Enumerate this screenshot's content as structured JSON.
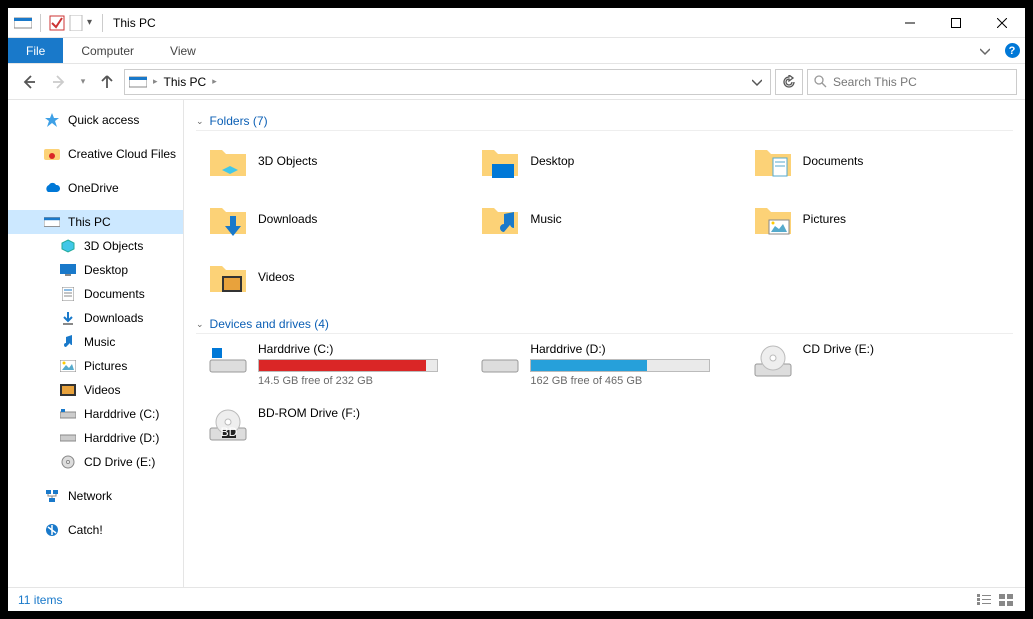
{
  "window": {
    "title": "This PC"
  },
  "menu": {
    "file": "File",
    "computer": "Computer",
    "view": "View"
  },
  "address": {
    "location": "This PC",
    "search_placeholder": "Search This PC"
  },
  "tree": {
    "quick_access": "Quick access",
    "creative_cloud": "Creative Cloud Files",
    "onedrive": "OneDrive",
    "this_pc": "This PC",
    "objects3d": "3D Objects",
    "desktop": "Desktop",
    "documents": "Documents",
    "downloads": "Downloads",
    "music": "Music",
    "pictures": "Pictures",
    "videos": "Videos",
    "harddrive_c": "Harddrive (C:)",
    "harddrive_d": "Harddrive (D:)",
    "cd_drive_e": "CD Drive (E:)",
    "network": "Network",
    "catch": "Catch!"
  },
  "groups": {
    "folders_header": "Folders (7)",
    "drives_header": "Devices and drives (4)"
  },
  "folders": {
    "objects3d": "3D Objects",
    "desktop": "Desktop",
    "documents": "Documents",
    "downloads": "Downloads",
    "music": "Music",
    "pictures": "Pictures",
    "videos": "Videos"
  },
  "drives": {
    "c": {
      "label": "Harddrive (C:)",
      "free": "14.5 GB free of 232 GB",
      "fill_pct": 94,
      "fill_color": "red"
    },
    "d": {
      "label": "Harddrive (D:)",
      "free": "162 GB free of 465 GB",
      "fill_pct": 65,
      "fill_color": "blue"
    },
    "e": {
      "label": "CD Drive (E:)"
    },
    "f": {
      "label": "BD-ROM Drive (F:)"
    }
  },
  "status": {
    "items": "11 items"
  }
}
